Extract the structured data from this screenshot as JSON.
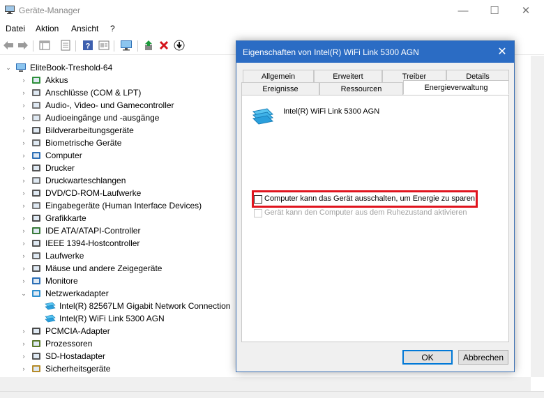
{
  "window": {
    "title": "Geräte-Manager",
    "controls": {
      "minimize": "—",
      "maximize": "☐",
      "close": "✕"
    }
  },
  "menu": [
    "Datei",
    "Aktion",
    "Ansicht",
    "?"
  ],
  "toolbar_icons": [
    "back-arrow-icon",
    "forward-arrow-icon",
    "properties-grid-icon",
    "show-hidden-icon",
    "help-icon",
    "view-icon",
    "monitor-icon",
    "update-driver-icon",
    "uninstall-x-icon",
    "download-icon"
  ],
  "tree": {
    "root": "EliteBook-Treshold-64",
    "categories": [
      {
        "label": "Akkus",
        "icon": "battery-icon"
      },
      {
        "label": "Anschlüsse (COM & LPT)",
        "icon": "port-icon"
      },
      {
        "label": "Audio-, Video- und Gamecontroller",
        "icon": "speaker-icon"
      },
      {
        "label": "Audioeingänge und -ausgänge",
        "icon": "audio-io-icon"
      },
      {
        "label": "Bildverarbeitungsgeräte",
        "icon": "camera-icon"
      },
      {
        "label": "Biometrische Geräte",
        "icon": "fingerprint-icon"
      },
      {
        "label": "Computer",
        "icon": "computer-icon"
      },
      {
        "label": "Drucker",
        "icon": "printer-icon"
      },
      {
        "label": "Druckwarteschlangen",
        "icon": "print-queue-icon"
      },
      {
        "label": "DVD/CD-ROM-Laufwerke",
        "icon": "disc-drive-icon"
      },
      {
        "label": "Eingabegeräte (Human Interface Devices)",
        "icon": "hid-icon"
      },
      {
        "label": "Grafikkarte",
        "icon": "display-adapter-icon"
      },
      {
        "label": "IDE ATA/ATAPI-Controller",
        "icon": "ide-controller-icon"
      },
      {
        "label": "IEEE 1394-Hostcontroller",
        "icon": "firewire-icon"
      },
      {
        "label": "Laufwerke",
        "icon": "disk-drive-icon"
      },
      {
        "label": "Mäuse und andere Zeigegeräte",
        "icon": "mouse-icon"
      },
      {
        "label": "Monitore",
        "icon": "monitor-icon"
      },
      {
        "label": "Netzwerkadapter",
        "icon": "network-adapter-icon",
        "expanded": true
      },
      {
        "label": "PCMCIA-Adapter",
        "icon": "pcmcia-icon"
      },
      {
        "label": "Prozessoren",
        "icon": "processor-icon"
      },
      {
        "label": "SD-Hostadapter",
        "icon": "sd-host-icon"
      },
      {
        "label": "Sicherheitsgeräte",
        "icon": "security-key-icon"
      }
    ],
    "network_children": [
      "Intel(R) 82567LM Gigabit Network Connection",
      "Intel(R) WiFi Link 5300 AGN"
    ]
  },
  "dialog": {
    "title": "Eigenschaften von Intel(R) WiFi Link 5300 AGN",
    "close": "✕",
    "tabs_row1": [
      "Allgemein",
      "Erweitert",
      "Treiber",
      "Details"
    ],
    "tabs_row2": [
      "Ereignisse",
      "Ressourcen",
      "Energieverwaltung"
    ],
    "active_tab": "Energieverwaltung",
    "device_name": "Intel(R) WiFi Link 5300 AGN",
    "option1": {
      "label": "Computer kann das Gerät ausschalten, um Energie zu sparen",
      "checked": false,
      "enabled": true
    },
    "option2": {
      "label": "Gerät kann den Computer aus dem Ruhezustand aktivieren",
      "checked": false,
      "enabled": false
    },
    "ok": "OK",
    "cancel": "Abbrechen"
  },
  "colors": {
    "dialog_titlebar": "#2b6cc4",
    "highlight_box": "#e0141e",
    "default_button_border": "#0078d7"
  }
}
